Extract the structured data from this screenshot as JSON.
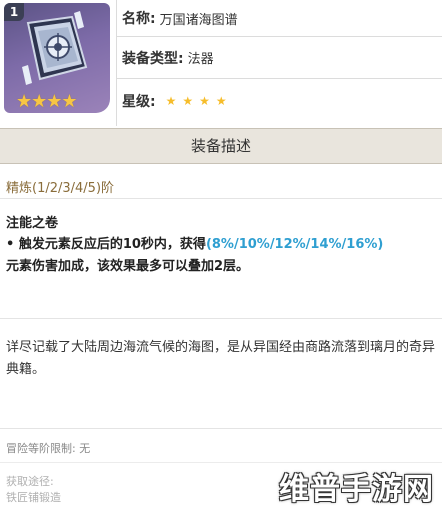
{
  "item": {
    "level_badge": "1",
    "thumbnail_stars": "★★★★",
    "name_label": "名称:",
    "name_value": "万国诸海图谱",
    "type_label": "装备类型:",
    "type_value": "法器",
    "rarity_label": "星级:",
    "rarity_stars": "★★★★",
    "rarity_value": 4
  },
  "section": {
    "header": "装备描述"
  },
  "refinement": {
    "label": "精炼(1/2/3/4/5)阶"
  },
  "passive": {
    "name": "注能之卷",
    "bullet": "• ",
    "line_before": "触发元素反应后的10秒内，获得",
    "highlight": "(8%/10%/12%/14%/16%)",
    "line_after": "元素伤害加成，该效果最多可以叠加2层。"
  },
  "lore": "详尽记载了大陆周边海流气候的海图，是从异国经由商路流落到璃月的奇异典籍。",
  "requirement": "冒险等阶限制: 无",
  "source": {
    "label": "获取途径:",
    "value": "铁匠铺锻造"
  },
  "watermark": "维普手游网",
  "colors": {
    "star": "#f6bd2b",
    "highlight": "#2f9fd1",
    "header_bg": "#e9e5dd",
    "thumbnail_bg": "#7d6ba8"
  }
}
